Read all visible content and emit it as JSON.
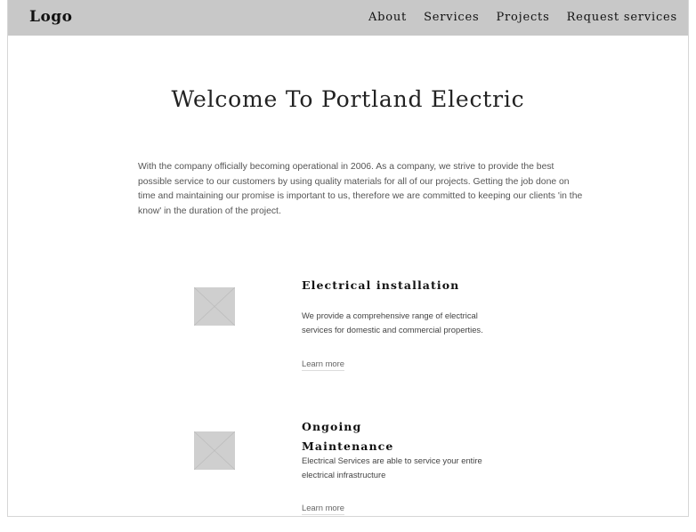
{
  "navbar": {
    "logo": "Logo",
    "links": [
      "About",
      "Services",
      "Projects",
      "Request services"
    ]
  },
  "hero": {
    "title": "Welcome To Portland Electric"
  },
  "intro": {
    "text": "With the company officially becoming operational in 2006. As a company, we strive to provide the best possible service to our customers by using quality materials for all of our projects. Getting the job done on time and maintaining our promise is important to us, therefore we are committed to keeping our clients 'in the know' in the duration of the project."
  },
  "services": [
    {
      "title": "Electrical installation",
      "description": "We provide a comprehensive range of electrical services for domestic and commercial properties.",
      "link": "Learn more"
    },
    {
      "title": "Ongoing Maintenance",
      "description": "Electrical Services are able to service your entire electrical infrastructure",
      "link": "Learn more"
    }
  ],
  "colors": {
    "navbar_bg": "#c8c8c8",
    "placeholder_bg": "#cfcfcf"
  },
  "icons": {
    "image_placeholder": "image-placeholder-icon"
  }
}
